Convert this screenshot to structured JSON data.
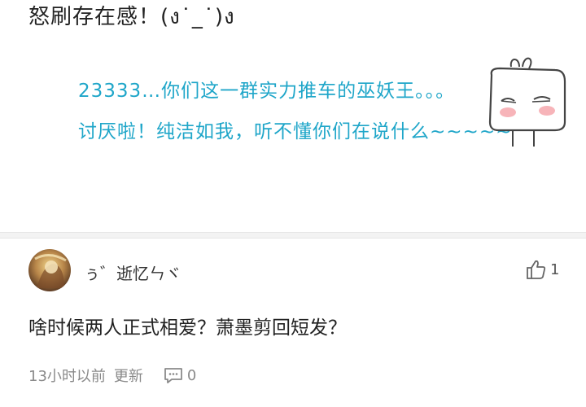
{
  "first_comment": {
    "text": "怒刷存在感！(ง˙_˙)ง",
    "sticker_lines": [
      "23333…你们这一群实力推车的巫妖王。。。",
      "讨厌啦！纯洁如我，听不懂你们在说什么~~~~~"
    ]
  },
  "reply": {
    "username": "ぅ゛逝忆ㄣヾ",
    "text": "啥时候两人正式相爱？萧墨剪回短发？",
    "time": "13小时以前",
    "update_label": "更新",
    "comment_count": "0",
    "like_count": "1"
  },
  "colors": {
    "sticker_text": "#1fa6c9",
    "band": "#f3f3f3",
    "meta_text": "#8a8a8a"
  },
  "icons": {
    "like": "thumbs-up-icon",
    "comment": "comment-bubble-icon",
    "sticker": "bunny-sticker"
  }
}
